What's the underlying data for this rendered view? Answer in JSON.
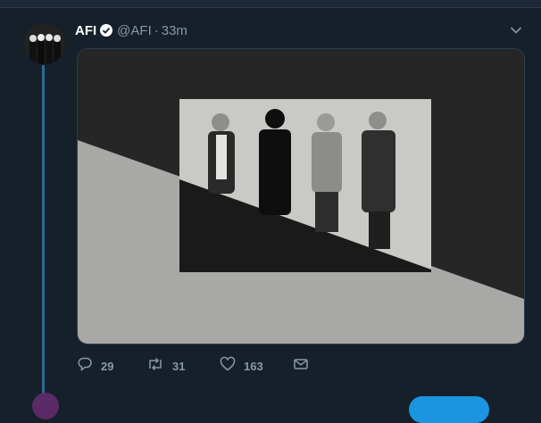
{
  "tweet": {
    "author_name": "AFI",
    "handle": "@AFI",
    "separator": "·",
    "time": "33m",
    "verified": true,
    "replies": "29",
    "retweets": "31",
    "likes": "163"
  },
  "icons": {
    "avatar": "band-avatar",
    "verified": "verified-badge-icon",
    "more": "chevron-down-icon",
    "reply": "reply-icon",
    "retweet": "retweet-icon",
    "like": "heart-icon",
    "dm": "envelope-icon"
  },
  "colors": {
    "background": "#15202b",
    "muted_text": "#8899a6",
    "thread_line": "#2b6a92",
    "accent": "#1b95e0"
  }
}
